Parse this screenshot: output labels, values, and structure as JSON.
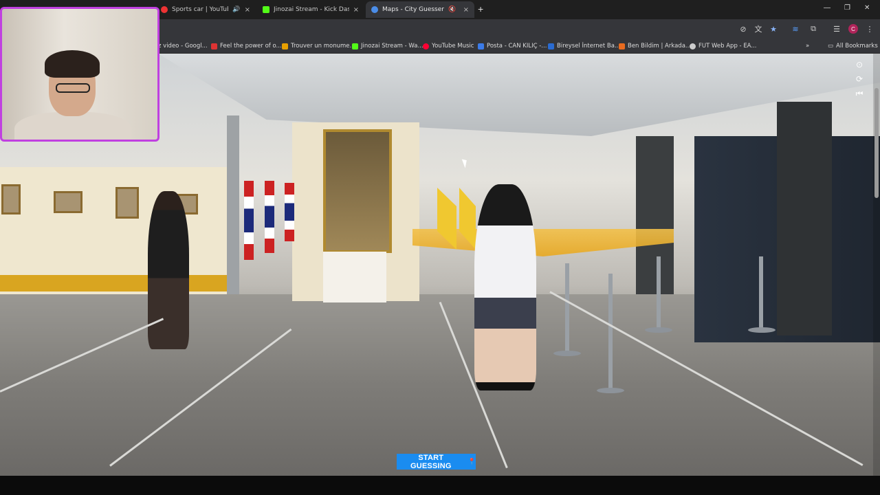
{
  "tabs": [
    {
      "title": "Sports car | YouTube Music",
      "favicon_color": "#e33"
    },
    {
      "title": "Jinozai Stream - Kick Dashboard",
      "favicon_color": "#53fc18"
    },
    {
      "title": "Maps - City Guesser",
      "favicon_color": "#4b8de8",
      "active": true
    }
  ],
  "bookmarks": [
    {
      "label": "z video - Googl...",
      "icon_color": "#888"
    },
    {
      "label": "Feel the power of o...",
      "icon_color": "#d33"
    },
    {
      "label": "Trouver un monume...",
      "icon_color": "#e8a000"
    },
    {
      "label": "Jinozai Stream - Wa...",
      "icon_color": "#53fc18"
    },
    {
      "label": "YouTube Music",
      "icon_color": "#f03"
    },
    {
      "label": "Posta - CAN KILIÇ -...",
      "icon_color": "#3b7be8"
    },
    {
      "label": "Bireysel İnternet Ba...",
      "icon_color": "#2a6bd1"
    },
    {
      "label": "Ben Bildim | Arkada...",
      "icon_color": "#e86b1f"
    },
    {
      "label": "FUT Web App - EA...",
      "icon_color": "#ccc"
    }
  ],
  "all_bookmarks": "All Bookmarks",
  "profile_initial": "C",
  "start_button": "START GUESSING",
  "icons": {
    "new_tab": "+",
    "close": "×",
    "minimize": "—",
    "restore": "❐",
    "win_close": "✕",
    "mute": "🔇",
    "star": "★",
    "menu": "⋮",
    "compass": "⊙",
    "refresh": "⟳",
    "back_to_start": "⏮",
    "pin": "📍",
    "chevron": "»"
  }
}
